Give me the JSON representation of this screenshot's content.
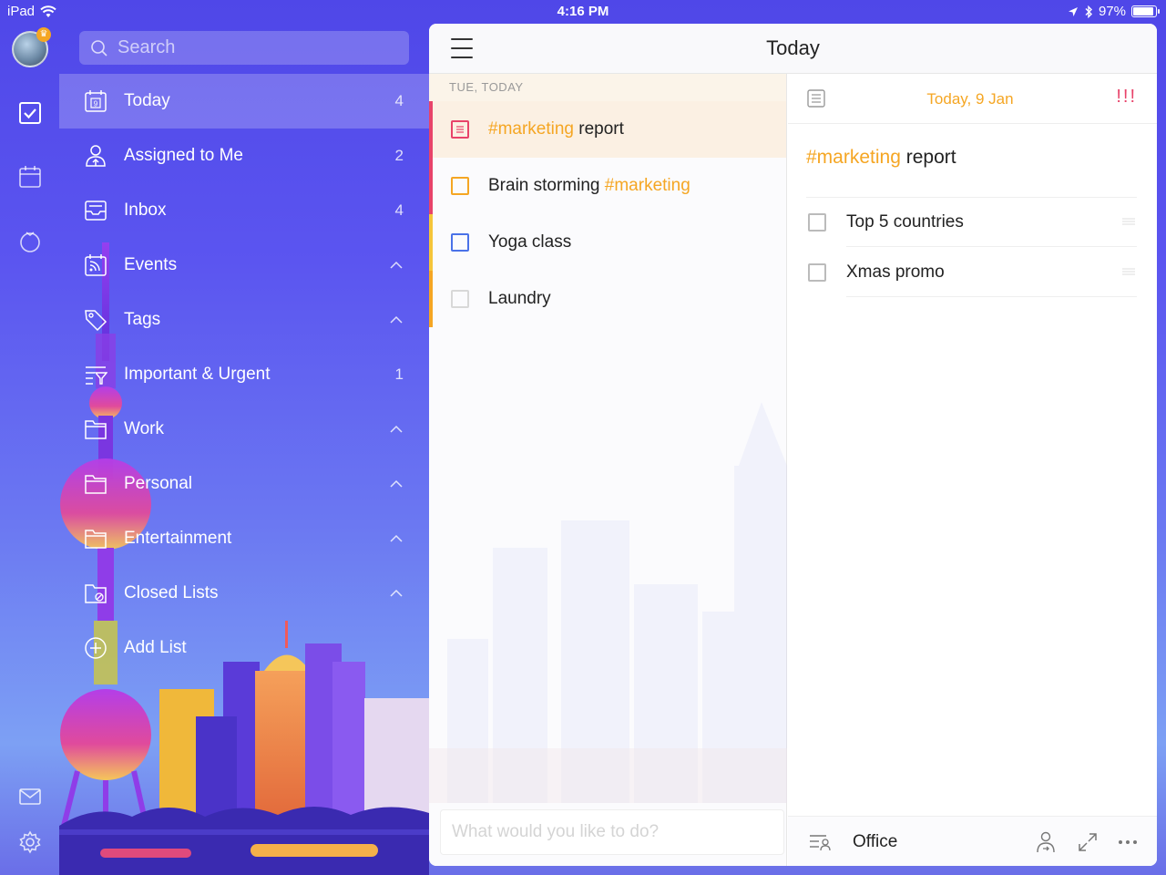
{
  "status_bar": {
    "device": "iPad",
    "time": "4:16 PM",
    "battery": "97%",
    "battery_level": 0.97
  },
  "search": {
    "placeholder": "Search"
  },
  "sidebar": {
    "items": [
      {
        "label": "Today",
        "count": "4",
        "icon": "calendar-day-icon"
      },
      {
        "label": "Assigned to Me",
        "count": "2",
        "icon": "assigned-user-icon"
      },
      {
        "label": "Inbox",
        "count": "4",
        "icon": "inbox-icon"
      },
      {
        "label": "Events",
        "count": "",
        "icon": "events-feed-icon"
      },
      {
        "label": "Tags",
        "count": "",
        "icon": "tag-icon"
      },
      {
        "label": "Important & Urgent",
        "count": "1",
        "icon": "filter-icon"
      },
      {
        "label": "Work",
        "count": "",
        "icon": "folder-icon"
      },
      {
        "label": "Personal",
        "count": "",
        "icon": "folder-icon"
      },
      {
        "label": "Entertainment",
        "count": "",
        "icon": "folder-icon"
      },
      {
        "label": "Closed Lists",
        "count": "",
        "icon": "closed-folder-icon"
      },
      {
        "label": "Add List",
        "count": "",
        "icon": "add-circle-icon"
      }
    ]
  },
  "main": {
    "title": "Today",
    "section_header": "TUE, TODAY",
    "tasks": [
      {
        "tag": "#marketing",
        "text": " report",
        "tag_first": true,
        "color": "#e8436a"
      },
      {
        "tag": "#marketing",
        "text": "Brain storming ",
        "tag_first": false,
        "color": "#f5a623"
      },
      {
        "tag": "",
        "text": "Yoga class",
        "tag_first": false,
        "color": "#4a72e8"
      },
      {
        "tag": "",
        "text": "Laundry",
        "tag_first": false,
        "color": "#d8d8d8"
      }
    ],
    "add_placeholder": "What would you like to do?"
  },
  "detail": {
    "date": "Today, 9 Jan",
    "priority": "!!!",
    "title_tag": "#marketing",
    "title_text": " report",
    "subtasks": [
      "Top 5 countries",
      "Xmas promo"
    ],
    "list_name": "Office"
  },
  "colors": {
    "accent": "#f5a623",
    "priority": "#e8436a",
    "sidebar_bg": "#5b55f0"
  }
}
